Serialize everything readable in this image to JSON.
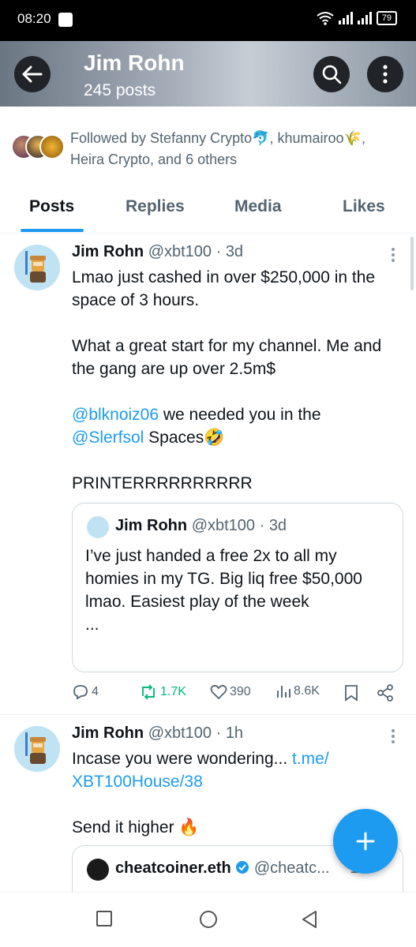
{
  "status_bar": {
    "time": "08:20",
    "battery": "79"
  },
  "header": {
    "name": "Jim Rohn",
    "post_count": "245 posts"
  },
  "followed_by": {
    "text": "Followed by Stefanny Crypto🐬, khumairoo🌾, Heira Crypto, and 6 others"
  },
  "tabs": [
    {
      "label": "Posts",
      "active": true
    },
    {
      "label": "Replies",
      "active": false
    },
    {
      "label": "Media",
      "active": false
    },
    {
      "label": "Likes",
      "active": false
    }
  ],
  "tweets": [
    {
      "name": "Jim Rohn",
      "handle_time": "@xbt100 · 3d",
      "text_line1": "Lmao just cashed in over $250,000 in the space of 3 hours.",
      "text_line2": "What a great start for my channel. Me and the gang are up over 2.5m$",
      "mention1": "@blknoiz06",
      "text_mid": " we needed you in the ",
      "mention2": "@Slerfsol",
      "text_end": " Spaces🤣",
      "text_line4": "PRINTERRRRRRRRRR",
      "quote": {
        "name": "Jim Rohn",
        "handle_time": "@xbt100 · 3d",
        "text": "I’ve just handed a free 2x to all my homies in my TG. Big liq free $50,000 lmao. Easiest play of the week",
        "more": "..."
      },
      "actions": {
        "replies": "4",
        "reposts": "1.7K",
        "likes": "390",
        "views": "8.6K"
      }
    },
    {
      "name": "Jim Rohn",
      "handle_time": "@xbt100 · 1h",
      "text_start": "Incase you were wondering... ",
      "link": "t.me/ XBT100House/38",
      "text_line2": "Send it higher 🔥",
      "quote": {
        "name": "cheatcoiner.eth",
        "handle": "@cheatc...",
        "tail": "1h"
      }
    }
  ],
  "colors": {
    "accent": "#1d9bf0",
    "repost_green": "#00ba7c",
    "text_primary": "#0f1419",
    "text_secondary": "#536471"
  },
  "icons": [
    "back-arrow-icon",
    "search-icon",
    "more-vertical-icon",
    "reply-icon",
    "repost-icon",
    "like-icon",
    "views-icon",
    "bookmark-icon",
    "share-icon",
    "plus-icon",
    "verified-icon"
  ]
}
